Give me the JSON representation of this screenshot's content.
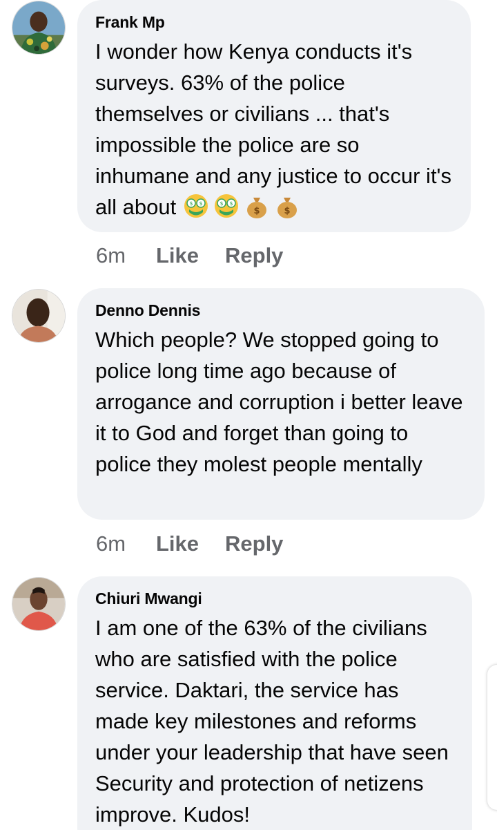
{
  "comments": [
    {
      "author": "Frank Mp",
      "text": "I wonder how Kenya conducts it's surveys. 63% of the police themselves or civilians ... that's impossible the police are so inhumane and any justice to occur it's all about",
      "emojis": [
        "money-mouth-face",
        "money-mouth-face",
        "money-bag",
        "money-bag"
      ],
      "time": "6m",
      "like_label": "Like",
      "reply_label": "Reply"
    },
    {
      "author": "Denno Dennis",
      "text": "Which people? We stopped going to police long time ago because of arrogance and corruption i better leave it to God and forget than going to police they molest people mentally",
      "time": "6m",
      "like_label": "Like",
      "reply_label": "Reply"
    },
    {
      "author": "Chiuri Mwangi",
      "text": "I am one of the 63% of the civilians who are satisfied with the police service. Daktari, the service has made key milestones and reforms under your leadership that have seen Security and protection of netizens improve. Kudos!"
    }
  ]
}
